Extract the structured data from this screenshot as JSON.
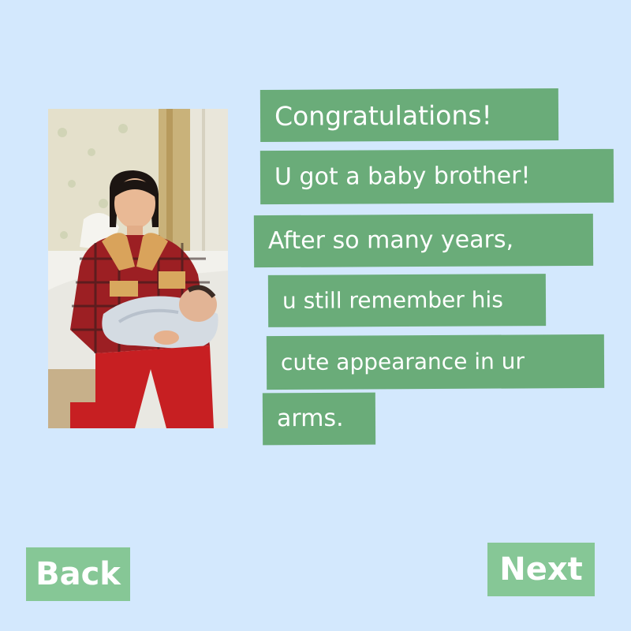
{
  "message": {
    "lines": [
      "Congratulations!",
      "U got a baby brother!",
      "After so many years,",
      "u still remember his",
      "cute appearance in ur",
      "arms."
    ]
  },
  "photo": {
    "subject": "girl-holding-baby-photo"
  },
  "navigation": {
    "back_label": "Back",
    "next_label": "Next"
  },
  "colors": {
    "background": "#d3e8fd",
    "text_strip": "#6aac79",
    "button": "#86c796",
    "text": "#ffffff"
  }
}
